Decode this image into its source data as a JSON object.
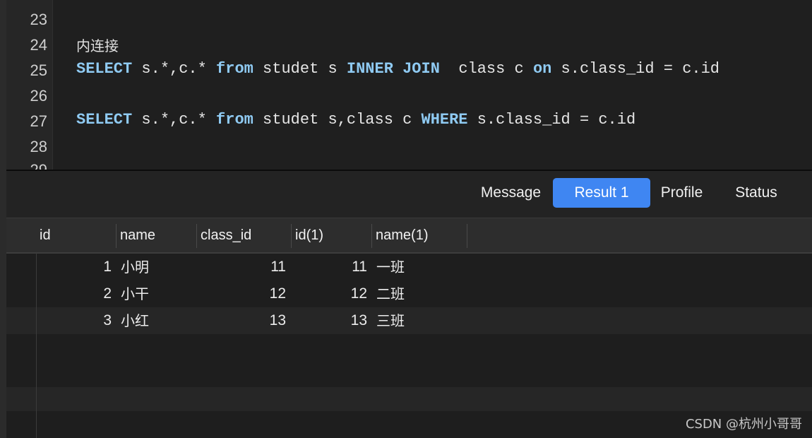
{
  "editor": {
    "lines": [
      {
        "num": "23",
        "segments": []
      },
      {
        "num": "24",
        "segments": [
          {
            "t": "内连接",
            "k": "comment"
          }
        ]
      },
      {
        "num": "25",
        "segments": [
          {
            "t": "SELECT",
            "k": "kw"
          },
          {
            "t": " s.*,c.* ",
            "k": "plain"
          },
          {
            "t": "from",
            "k": "kw"
          },
          {
            "t": " studet s ",
            "k": "plain"
          },
          {
            "t": "INNER JOIN",
            "k": "kw"
          },
          {
            "t": "  class c ",
            "k": "plain"
          },
          {
            "t": "on",
            "k": "kw"
          },
          {
            "t": " s.class_id = c.id",
            "k": "plain"
          }
        ]
      },
      {
        "num": "26",
        "segments": []
      },
      {
        "num": "27",
        "segments": [
          {
            "t": "SELECT",
            "k": "kw"
          },
          {
            "t": " s.*,c.* ",
            "k": "plain"
          },
          {
            "t": "from",
            "k": "kw"
          },
          {
            "t": " studet s,class c ",
            "k": "plain"
          },
          {
            "t": "WHERE",
            "k": "kw"
          },
          {
            "t": " s.class_id = c.id",
            "k": "plain"
          }
        ]
      },
      {
        "num": "28",
        "segments": []
      },
      {
        "num": "29",
        "segments": []
      }
    ]
  },
  "tabs": [
    {
      "label": "Message",
      "active": false
    },
    {
      "label": "Result 1",
      "active": true
    },
    {
      "label": "Profile",
      "active": false
    },
    {
      "label": "Status",
      "active": false
    }
  ],
  "grid": {
    "columns": [
      "id",
      "name",
      "class_id",
      "id(1)",
      "name(1)"
    ],
    "rows": [
      [
        "1",
        "小明",
        "11",
        "11",
        "一班"
      ],
      [
        "2",
        "小干",
        "12",
        "12",
        "二班"
      ],
      [
        "3",
        "小红",
        "13",
        "13",
        "三班"
      ]
    ]
  },
  "watermark": "CSDN @杭州小哥哥",
  "colors": {
    "accent": "#3f86f2",
    "keyword": "#8fcaf2",
    "background": "#1e1e1e"
  }
}
